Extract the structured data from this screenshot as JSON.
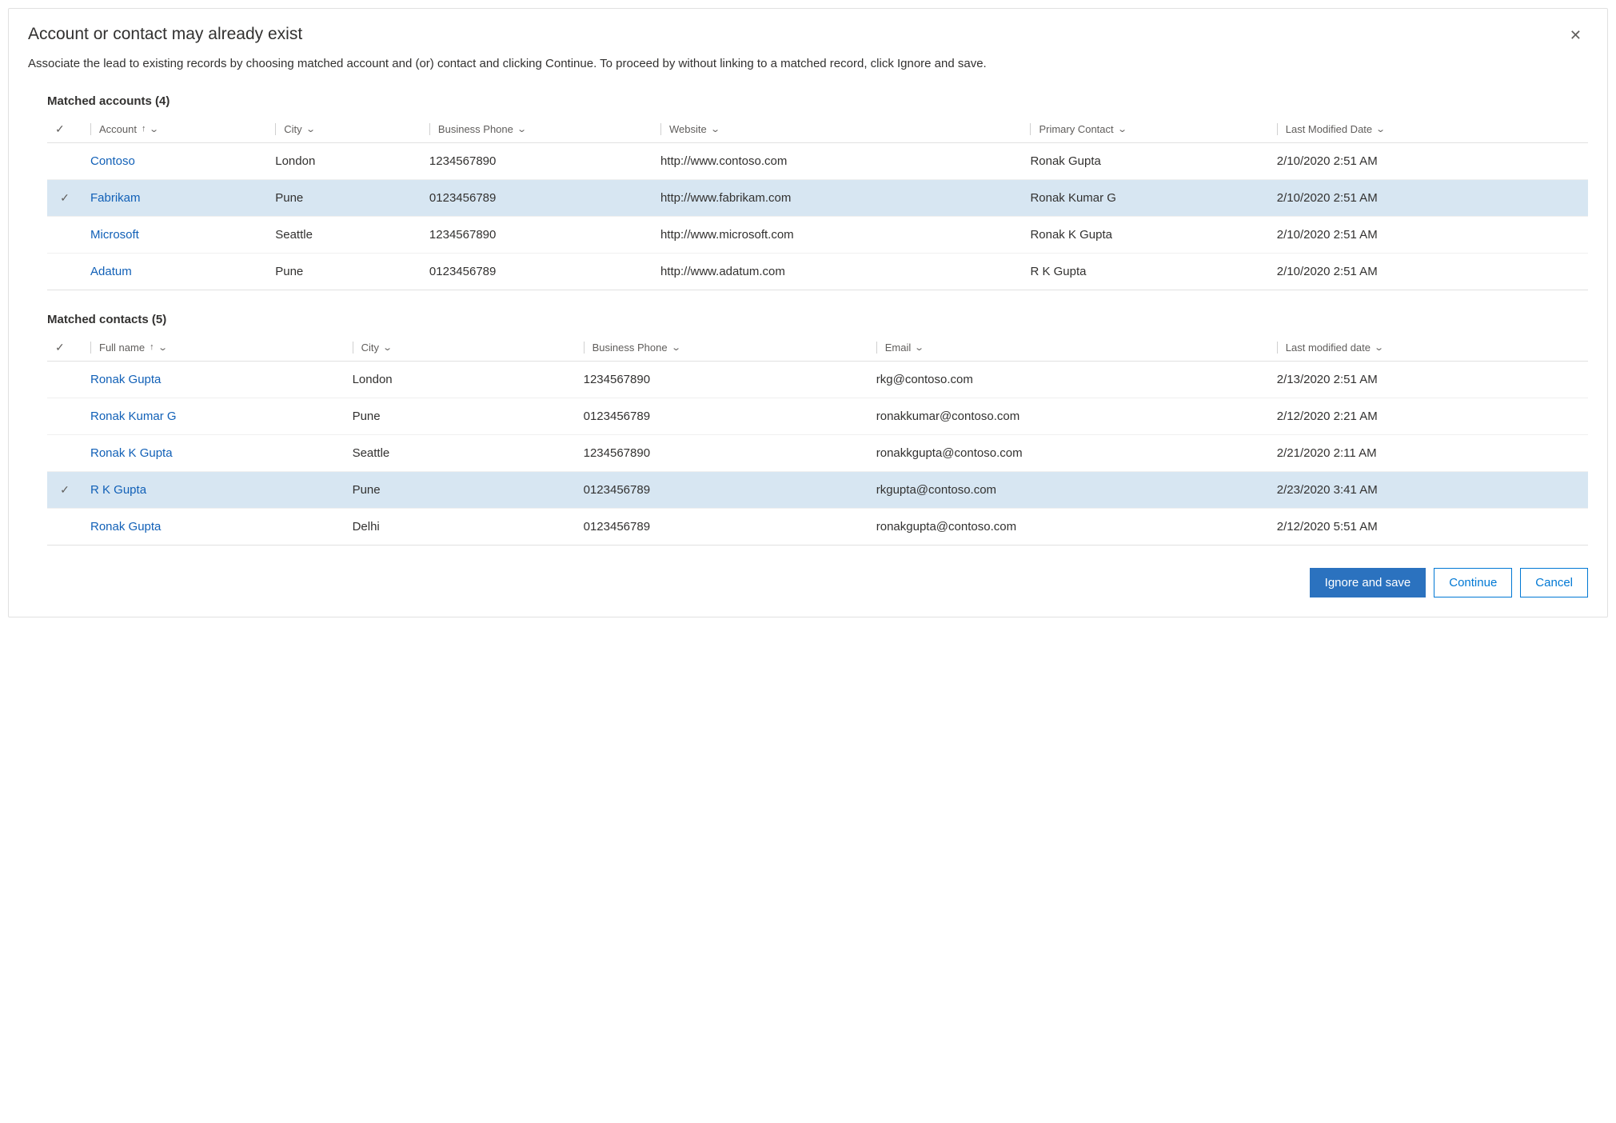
{
  "dialog": {
    "title": "Account or contact may already exist",
    "description": "Associate the lead to existing records by choosing matched account and (or) contact and clicking Continue. To proceed by without linking to a matched record, click Ignore and save."
  },
  "accounts": {
    "title": "Matched accounts (4)",
    "columns": {
      "account": "Account",
      "city": "City",
      "phone": "Business Phone",
      "website": "Website",
      "primary": "Primary Contact",
      "modified": "Last Modified Date"
    },
    "rows": [
      {
        "selected": false,
        "account": "Contoso",
        "city": "London",
        "phone": "1234567890",
        "website": "http://www.contoso.com",
        "primary": "Ronak Gupta",
        "modified": "2/10/2020 2:51 AM"
      },
      {
        "selected": true,
        "account": "Fabrikam",
        "city": "Pune",
        "phone": "0123456789",
        "website": "http://www.fabrikam.com",
        "primary": "Ronak Kumar G",
        "modified": "2/10/2020 2:51 AM"
      },
      {
        "selected": false,
        "account": "Microsoft",
        "city": "Seattle",
        "phone": "1234567890",
        "website": "http://www.microsoft.com",
        "primary": "Ronak K Gupta",
        "modified": "2/10/2020 2:51 AM"
      },
      {
        "selected": false,
        "account": "Adatum",
        "city": "Pune",
        "phone": "0123456789",
        "website": "http://www.adatum.com",
        "primary": "R K Gupta",
        "modified": "2/10/2020 2:51 AM"
      }
    ]
  },
  "contacts": {
    "title": "Matched contacts (5)",
    "columns": {
      "fullname": "Full name",
      "city": "City",
      "phone": "Business Phone",
      "email": "Email",
      "modified": "Last modified date"
    },
    "rows": [
      {
        "selected": false,
        "fullname": "Ronak Gupta",
        "city": "London",
        "phone": "1234567890",
        "email": "rkg@contoso.com",
        "modified": "2/13/2020 2:51 AM"
      },
      {
        "selected": false,
        "fullname": "Ronak Kumar G",
        "city": "Pune",
        "phone": "0123456789",
        "email": "ronakkumar@contoso.com",
        "modified": "2/12/2020 2:21 AM"
      },
      {
        "selected": false,
        "fullname": "Ronak K Gupta",
        "city": "Seattle",
        "phone": "1234567890",
        "email": "ronakkgupta@contoso.com",
        "modified": "2/21/2020 2:11 AM"
      },
      {
        "selected": true,
        "fullname": "R K Gupta",
        "city": "Pune",
        "phone": "0123456789",
        "email": "rkgupta@contoso.com",
        "modified": "2/23/2020 3:41 AM"
      },
      {
        "selected": false,
        "fullname": "Ronak Gupta",
        "city": "Delhi",
        "phone": "0123456789",
        "email": "ronakgupta@contoso.com",
        "modified": "2/12/2020 5:51 AM"
      }
    ]
  },
  "footer": {
    "ignore": "Ignore and save",
    "continue": "Continue",
    "cancel": "Cancel"
  }
}
